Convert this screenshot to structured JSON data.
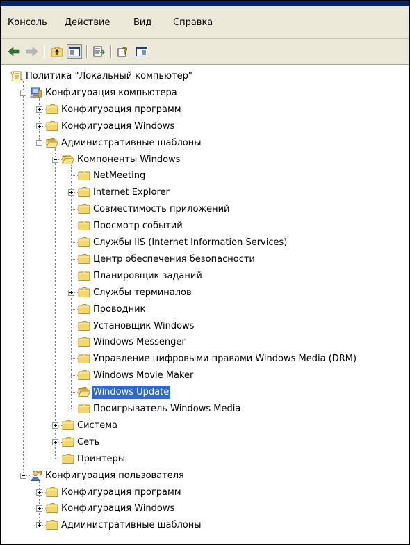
{
  "menu": {
    "items": [
      {
        "pre": "",
        "hot": "К",
        "post": "онсоль"
      },
      {
        "pre": "",
        "hot": "Д",
        "post": "ействие"
      },
      {
        "pre": "",
        "hot": "В",
        "post": "ид"
      },
      {
        "pre": "",
        "hot": "С",
        "post": "правка"
      }
    ]
  },
  "toolbar": {
    "buttons": [
      "back-arrow-icon",
      "forward-arrow-icon",
      "up-folder-icon",
      "show-hide-tree-icon",
      "export-list-icon",
      "help-icon",
      "show-hide-action-pane-icon"
    ]
  },
  "tree": {
    "nodes": [
      {
        "label": "Политика \"Локальный компьютер\"",
        "icon": "policy-scroll-icon"
      },
      {
        "label": "Конфигурация компьютера",
        "icon": "computer-icon"
      },
      {
        "label": "Конфигурация программ",
        "icon": "folder-icon"
      },
      {
        "label": "Конфигурация Windows",
        "icon": "folder-icon"
      },
      {
        "label": "Административные шаблоны",
        "icon": "folder-open-icon"
      },
      {
        "label": "Компоненты Windows",
        "icon": "folder-open-icon"
      },
      {
        "label": "NetMeeting",
        "icon": "folder-icon"
      },
      {
        "label": "Internet Explorer",
        "icon": "folder-icon"
      },
      {
        "label": "Совместимость приложений",
        "icon": "folder-icon"
      },
      {
        "label": "Просмотр событий",
        "icon": "folder-icon"
      },
      {
        "label": "Службы IIS (Internet Information Services)",
        "icon": "folder-icon"
      },
      {
        "label": "Центр обеспечения безопасности",
        "icon": "folder-icon"
      },
      {
        "label": "Планировщик заданий",
        "icon": "folder-icon"
      },
      {
        "label": "Службы терминалов",
        "icon": "folder-icon"
      },
      {
        "label": "Проводник",
        "icon": "folder-icon"
      },
      {
        "label": "Установщик Windows",
        "icon": "folder-icon"
      },
      {
        "label": "Windows Messenger",
        "icon": "folder-icon"
      },
      {
        "label": "Управление цифровыми правами Windows Media (DRM)",
        "icon": "folder-icon"
      },
      {
        "label": "Windows Movie Maker",
        "icon": "folder-icon"
      },
      {
        "label": "Windows Update",
        "icon": "folder-open-icon",
        "selected": true
      },
      {
        "label": "Проигрыватель Windows Media",
        "icon": "folder-icon"
      },
      {
        "label": "Система",
        "icon": "folder-icon"
      },
      {
        "label": "Сеть",
        "icon": "folder-icon"
      },
      {
        "label": "Принтеры",
        "icon": "folder-icon"
      },
      {
        "label": "Конфигурация пользователя",
        "icon": "user-icon"
      },
      {
        "label": "Конфигурация программ",
        "icon": "folder-icon"
      },
      {
        "label": "Конфигурация Windows",
        "icon": "folder-icon"
      },
      {
        "label": "Административные шаблоны",
        "icon": "folder-icon"
      }
    ]
  },
  "colors": {
    "selection": "#316ac5",
    "toolbar": "#ece9d8",
    "titlebar": "#0a246a",
    "folder": "#f5d66b"
  }
}
